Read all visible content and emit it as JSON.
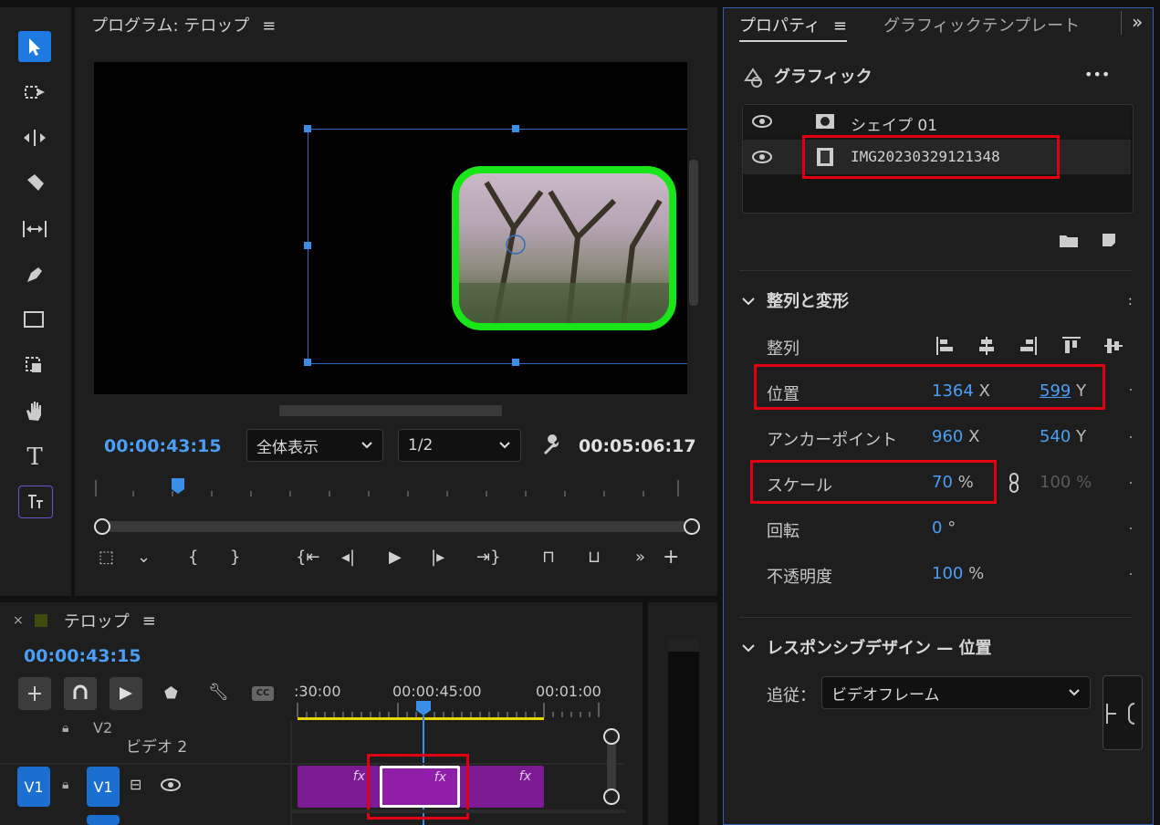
{
  "monitor": {
    "title": "プログラム: テロップ",
    "timecode": "00:00:43:15",
    "zoom": "全体表示",
    "resolution": "1/2",
    "duration": "00:05:06:17"
  },
  "timeline": {
    "title": "テロップ",
    "timecode": "00:00:43:15",
    "ruler": [
      ":30:00",
      "00:00:45:00",
      "00:01:00"
    ],
    "tracks": {
      "v2_label": "V2",
      "v2_name": "ビデオ 2",
      "v1_source": "V1",
      "v1_target": "V1"
    },
    "fx": "fx"
  },
  "properties": {
    "tab_properties": "プロパティ",
    "tab_templates": "グラフィックテンプレート",
    "section_graphic": "グラフィック",
    "more": "•••",
    "layers": [
      "シェイプ 01",
      "IMG20230329121348"
    ],
    "section_align": "整列と変形",
    "align_label": "整列",
    "position": {
      "label": "位置",
      "x": "1364",
      "x_unit": "X",
      "y": "599",
      "y_unit": "Y"
    },
    "anchor": {
      "label": "アンカーポイント",
      "x": "960",
      "x_unit": "X",
      "y": "540",
      "y_unit": "Y"
    },
    "scale": {
      "label": "スケール",
      "value": "70",
      "unit": "%",
      "value2": "100 %"
    },
    "rotation": {
      "label": "回転",
      "value": "0",
      "unit": "°"
    },
    "opacity": {
      "label": "不透明度",
      "value": "100",
      "unit": "%"
    },
    "section_responsive": "レスポンシブデザイン — 位置",
    "follow_label": "追従：",
    "follow_value": "ビデオフレーム"
  },
  "colors": {
    "accent": "#4a9ff5",
    "highlight": "#e00012",
    "clip": "#7b1a93",
    "frame": "#19e619"
  }
}
